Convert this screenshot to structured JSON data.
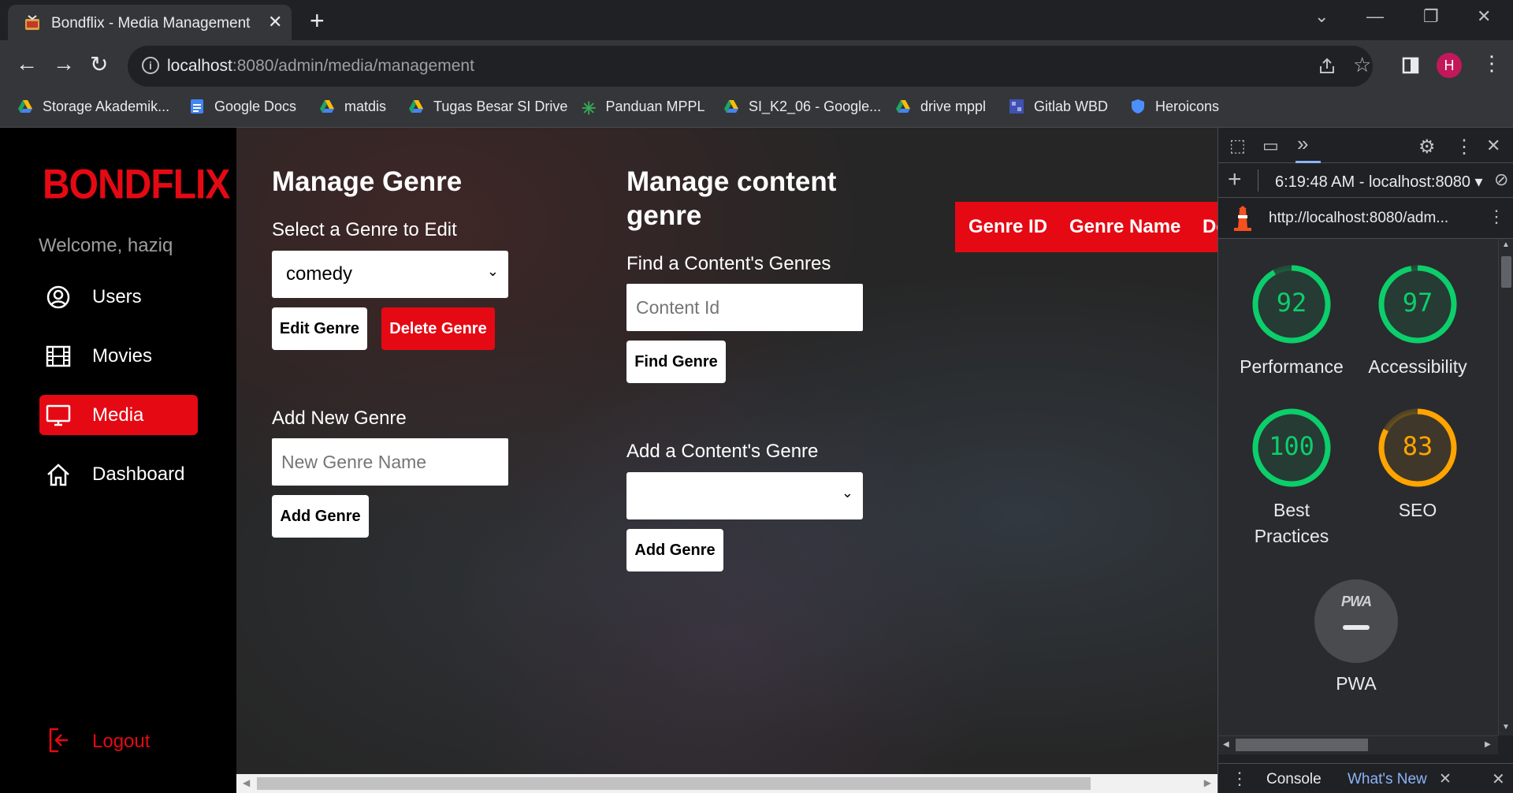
{
  "browser": {
    "tab_title": "Bondflix - Media Management",
    "url_host": "localhost",
    "url_path": ":8080/admin/media/management",
    "profile_initial": "H",
    "bookmarks": [
      {
        "label": "Storage Akademik...",
        "icon": "google-drive-icon"
      },
      {
        "label": "Google Docs",
        "icon": "google-docs-icon"
      },
      {
        "label": "matdis",
        "icon": "google-drive-icon"
      },
      {
        "label": "Tugas Besar SI Drive",
        "icon": "google-drive-icon"
      },
      {
        "label": "Panduan MPPL",
        "icon": "green-asterisk-icon"
      },
      {
        "label": "SI_K2_06 - Google...",
        "icon": "google-drive-icon"
      },
      {
        "label": "drive mppl",
        "icon": "google-drive-icon"
      },
      {
        "label": "Gitlab WBD",
        "icon": "gitlab-icon"
      },
      {
        "label": "Heroicons",
        "icon": "heroicons-shield-icon"
      }
    ]
  },
  "sidebar": {
    "logo": "BONDFLIX",
    "welcome": "Welcome, haziq",
    "items": [
      {
        "label": "Users",
        "icon": "user-circle-icon",
        "active": false
      },
      {
        "label": "Movies",
        "icon": "film-icon",
        "active": false
      },
      {
        "label": "Media",
        "icon": "monitor-icon",
        "active": true
      },
      {
        "label": "Dashboard",
        "icon": "home-icon",
        "active": false
      }
    ],
    "logout": "Logout"
  },
  "manage_genre": {
    "title": "Manage Genre",
    "select_label": "Select a Genre to Edit",
    "selected_genre": "comedy",
    "edit_button": "Edit Genre",
    "delete_button": "Delete Genre",
    "add_label": "Add New Genre",
    "add_placeholder": "New Genre Name",
    "add_button": "Add Genre"
  },
  "manage_content_genre": {
    "title_line1": "Manage content",
    "title_line2": "genre",
    "find_label": "Find a Content's Genres",
    "find_placeholder": "Content Id",
    "find_button": "Find Genre",
    "add_label": "Add a Content's Genre",
    "add_selected": "",
    "add_button": "Add Genre"
  },
  "genre_table": {
    "headers": [
      "Genre ID",
      "Genre Name",
      "De"
    ]
  },
  "devtools": {
    "report_time": "6:19:48 AM - localhost:8080",
    "report_url": "http://localhost:8080/adm...",
    "scores": [
      {
        "label": "Performance",
        "value": 92,
        "color": "#0cce6b"
      },
      {
        "label": "Accessibility",
        "value": 97,
        "color": "#0cce6b"
      },
      {
        "label": "Best Practices",
        "label_line1": "Best",
        "label_line2": "Practices",
        "value": 100,
        "color": "#0cce6b"
      },
      {
        "label": "SEO",
        "value": 83,
        "color": "#ffa400"
      }
    ],
    "pwa_badge": "PWA",
    "pwa_label": "PWA",
    "drawer_tabs": [
      "Console",
      "What's New"
    ]
  },
  "colors": {
    "brand_red": "#e50914",
    "score_good": "#0cce6b",
    "score_average": "#ffa400"
  }
}
